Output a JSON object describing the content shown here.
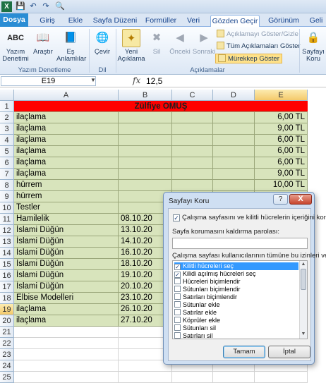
{
  "title_bar": {
    "logo": "X",
    "quick_access_icons": [
      "save-icon",
      "undo-icon",
      "redo-icon",
      "print-preview-icon"
    ]
  },
  "tabs": [
    {
      "label": "Dosya"
    },
    {
      "label": "Giriş"
    },
    {
      "label": "Ekle"
    },
    {
      "label": "Sayfa Düzeni"
    },
    {
      "label": "Formüller"
    },
    {
      "label": "Veri"
    },
    {
      "label": "Gözden Geçir"
    },
    {
      "label": "Görünüm"
    },
    {
      "label": "Geli"
    }
  ],
  "ribbon": {
    "buttons": {
      "spelling": "Yazım Denetimi",
      "research": "Araştır",
      "thesaurus": "Eş Anlamlılar",
      "translate": "Çevir",
      "new_comment": "Yeni Açıklama",
      "delete": "Sil",
      "previous": "Önceki",
      "next": "Sonraki",
      "protect_sheet": "Sayfayı Koru"
    },
    "small_buttons": {
      "show_hide_comment": "Açıklamayı Göster/Gizle",
      "show_all_comments": "Tüm Açıklamaları Göster",
      "show_ink": "Mürekkep Göster"
    },
    "groups": {
      "proofing": "Yazım Denetleme",
      "language": "Dil",
      "comments": "Açıklamalar"
    }
  },
  "formula_bar": {
    "name_box": "E19",
    "fx": "fx",
    "value": "12,5"
  },
  "sheet": {
    "columns": [
      "A",
      "B",
      "C",
      "D",
      "E"
    ],
    "selected_column": "E",
    "selected_row": "19",
    "title": "Zülfiye OMUŞ",
    "rows": [
      {
        "num": "1"
      },
      {
        "num": "2",
        "a": "ilaçlama",
        "b": "",
        "e": "6,00 TL"
      },
      {
        "num": "3",
        "a": "ilaçlama",
        "b": "",
        "e": "9,00 TL"
      },
      {
        "num": "4",
        "a": "ilaçlama",
        "b": "",
        "e": "6,00 TL"
      },
      {
        "num": "5",
        "a": "ilaçlama",
        "b": "",
        "e": "6,00 TL"
      },
      {
        "num": "6",
        "a": "ilaçlama",
        "b": "",
        "e": "6,00 TL"
      },
      {
        "num": "7",
        "a": "ilaçlama",
        "b": "",
        "e": "9,00 TL"
      },
      {
        "num": "8",
        "a": "hürrem",
        "b": "",
        "e": "10,00 TL"
      },
      {
        "num": "9",
        "a": "hürrem",
        "b": "",
        "e": ""
      },
      {
        "num": "10",
        "a": "Testler",
        "b": "",
        "e": ""
      },
      {
        "num": "11",
        "a": "Hamilelik",
        "b": "08.10.20",
        "e": ""
      },
      {
        "num": "12",
        "a": "İslami Düğün",
        "b": "13.10.20",
        "e": ""
      },
      {
        "num": "13",
        "a": "İslami Düğün",
        "b": "14.10.20",
        "e": ""
      },
      {
        "num": "14",
        "a": "İslami Düğün",
        "b": "16.10.20",
        "e": ""
      },
      {
        "num": "15",
        "a": "İslami Düğün",
        "b": "18.10.20",
        "e": ""
      },
      {
        "num": "16",
        "a": "İslami Düğün",
        "b": "19.10.20",
        "e": ""
      },
      {
        "num": "17",
        "a": "İslami Düğün",
        "b": "20.10.20",
        "e": ""
      },
      {
        "num": "18",
        "a": "Elbise Modelleri",
        "b": "23.10.20",
        "e": ""
      },
      {
        "num": "19",
        "a": "ilaçlama",
        "b": "26.10.20",
        "e": ""
      },
      {
        "num": "20",
        "a": "ilaçlama",
        "b": "27.10.20",
        "e": ""
      },
      {
        "num": "21"
      },
      {
        "num": "22"
      },
      {
        "num": "23"
      },
      {
        "num": "24"
      },
      {
        "num": "25"
      }
    ]
  },
  "dialog": {
    "title": "Sayfayı Koru",
    "help": "?",
    "close": "X",
    "protect_checkbox": {
      "label": "Çalışma sayfasını ve kilitli hücrelerin içeriğini koru",
      "checked": true
    },
    "password_label": "Sayfa korumasını kaldırma parolası:",
    "password_value": "",
    "permissions_label": "Çalışma sayfası kullanıcılarının tümüne bu izinleri ver:",
    "permissions": [
      {
        "label": "Kilitli hücreleri seç",
        "checked": true,
        "selected": true
      },
      {
        "label": "Kilidi açılmış hücreleri seç",
        "checked": true
      },
      {
        "label": "Hücreleri biçimlendir",
        "checked": false
      },
      {
        "label": "Sütunları biçimlendir",
        "checked": false
      },
      {
        "label": "Satırları biçimlendir",
        "checked": false
      },
      {
        "label": "Sütunlar ekle",
        "checked": false
      },
      {
        "label": "Satırlar ekle",
        "checked": false
      },
      {
        "label": "Köprüler ekle",
        "checked": false
      },
      {
        "label": "Sütunları sil",
        "checked": false
      },
      {
        "label": "Satırları sil",
        "checked": false
      }
    ],
    "ok": "Tamam",
    "cancel": "İptal"
  }
}
